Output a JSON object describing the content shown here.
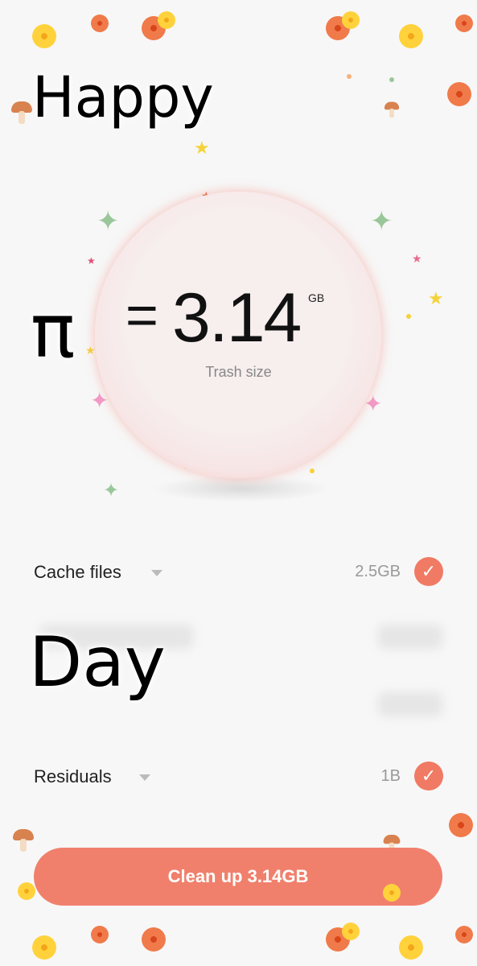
{
  "overlay": {
    "top_word": "Happy",
    "pi_symbol": "π",
    "bottom_word": "Day"
  },
  "trash": {
    "equals": "=",
    "value": "3.14",
    "unit": "GB",
    "caption": "Trash size"
  },
  "rows": [
    {
      "label": "Cache files",
      "size": "2.5GB",
      "checked": true
    },
    {
      "label": "Residuals",
      "size": "1B",
      "checked": true
    }
  ],
  "check_glyph": "✓",
  "cleanup_button": "Clean up 3.14GB",
  "colors": {
    "accent": "#f07a63",
    "button": "#f0806c",
    "background": "#f7f7f7"
  },
  "icons": [
    "yellow-flower-icon",
    "orange-flower-icon",
    "mushroom-icon",
    "star-icon",
    "sparkle-icon",
    "dropdown-arrow-icon",
    "checkmark-icon"
  ]
}
